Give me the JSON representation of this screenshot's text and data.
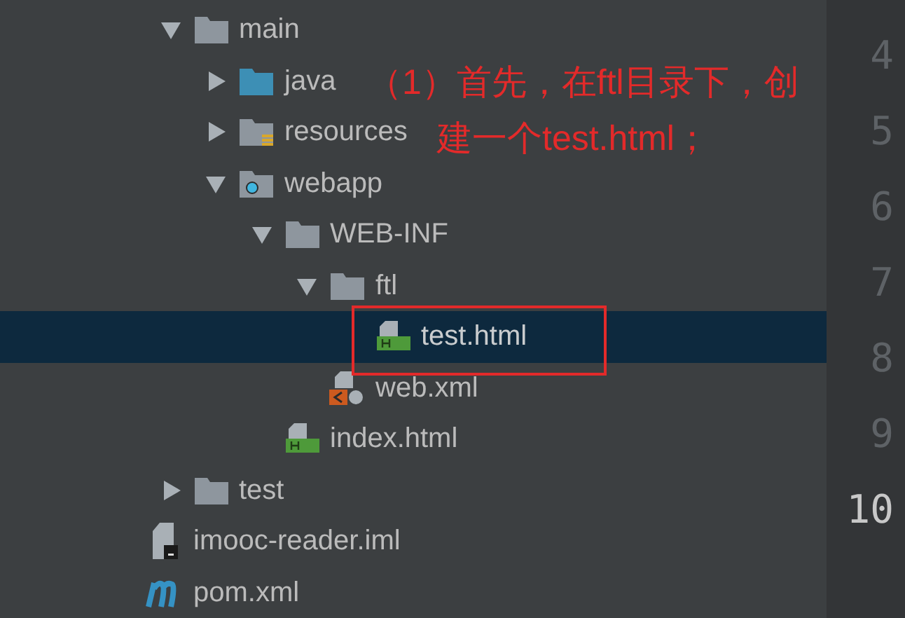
{
  "tree": {
    "nested_items": [
      {
        "name": "main",
        "kind": "folder",
        "expanded": true,
        "selected": false,
        "children": [
          {
            "name": "java",
            "kind": "source-folder",
            "expanded": false,
            "selected": false
          },
          {
            "name": "resources",
            "kind": "resources-folder",
            "expanded": false,
            "selected": false
          },
          {
            "name": "webapp",
            "kind": "web-folder",
            "expanded": true,
            "selected": false,
            "children": [
              {
                "name": "WEB-INF",
                "kind": "folder",
                "expanded": true,
                "selected": false,
                "children": [
                  {
                    "name": "ftl",
                    "kind": "folder",
                    "expanded": true,
                    "selected": false,
                    "children": [
                      {
                        "name": "test.html",
                        "kind": "html",
                        "selected": true
                      }
                    ]
                  },
                  {
                    "name": "web.xml",
                    "kind": "xml",
                    "selected": false
                  }
                ]
              },
              {
                "name": "index.html",
                "kind": "html",
                "selected": false
              }
            ]
          }
        ]
      },
      {
        "name": "test",
        "kind": "folder",
        "expanded": false,
        "selected": false
      }
    ],
    "items": [
      {
        "name": "imooc-reader.iml",
        "kind": "iml",
        "selected": false
      },
      {
        "name": "pom.xml",
        "kind": "maven",
        "selected": false
      }
    ]
  },
  "gutter": {
    "line_numbers": [
      {
        "number": "4",
        "selected": false
      },
      {
        "number": "5",
        "selected": false
      },
      {
        "number": "6",
        "selected": false
      },
      {
        "number": "7",
        "selected": false
      },
      {
        "number": "8",
        "selected": false
      },
      {
        "number": "9",
        "selected": false
      },
      {
        "number": "10",
        "selected": true
      }
    ]
  },
  "annotation": {
    "lines": [
      "（1）首先，在ftl目录下，创",
      "建一个test.html；"
    ]
  }
}
